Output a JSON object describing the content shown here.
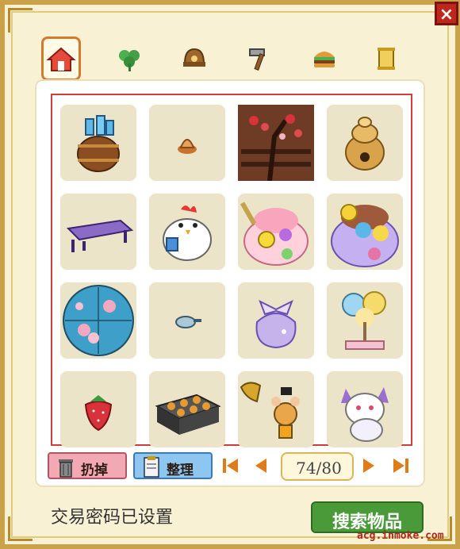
{
  "window": {
    "close_label": "×"
  },
  "tabs": [
    {
      "icon": "house-icon",
      "active": true
    },
    {
      "icon": "clover-icon",
      "active": false
    },
    {
      "icon": "helmet-icon",
      "active": false
    },
    {
      "icon": "hammer-icon",
      "active": false
    },
    {
      "icon": "burger-icon",
      "active": false
    },
    {
      "icon": "scroll-icon",
      "active": false
    }
  ],
  "inventory": {
    "items": [
      {
        "name": "barrel-with-bottles-icon"
      },
      {
        "name": "small-cone-icon"
      },
      {
        "name": "blossom-tree-fence-icon"
      },
      {
        "name": "beehive-icon"
      },
      {
        "name": "purple-bench-icon"
      },
      {
        "name": "chicken-plush-icon"
      },
      {
        "name": "flower-cake-pink-icon"
      },
      {
        "name": "flower-cake-green-icon"
      },
      {
        "name": "blossom-umbrella-icon"
      },
      {
        "name": "small-bowl-icon"
      },
      {
        "name": "ribbon-pouch-icon"
      },
      {
        "name": "cotton-candy-lamp-icon"
      },
      {
        "name": "strawberry-icon"
      },
      {
        "name": "cookie-tray-icon"
      },
      {
        "name": "gramophone-mouse-icon"
      },
      {
        "name": "white-cat-plush-icon"
      }
    ]
  },
  "toolbar": {
    "discard_label": "扔掉",
    "sort_label": "整理",
    "page_text": "74/80"
  },
  "status": {
    "text": "交易密码已设置"
  },
  "search_button": {
    "label": "搜索物品"
  },
  "watermark": {
    "text": "acg.inmoke.com"
  }
}
